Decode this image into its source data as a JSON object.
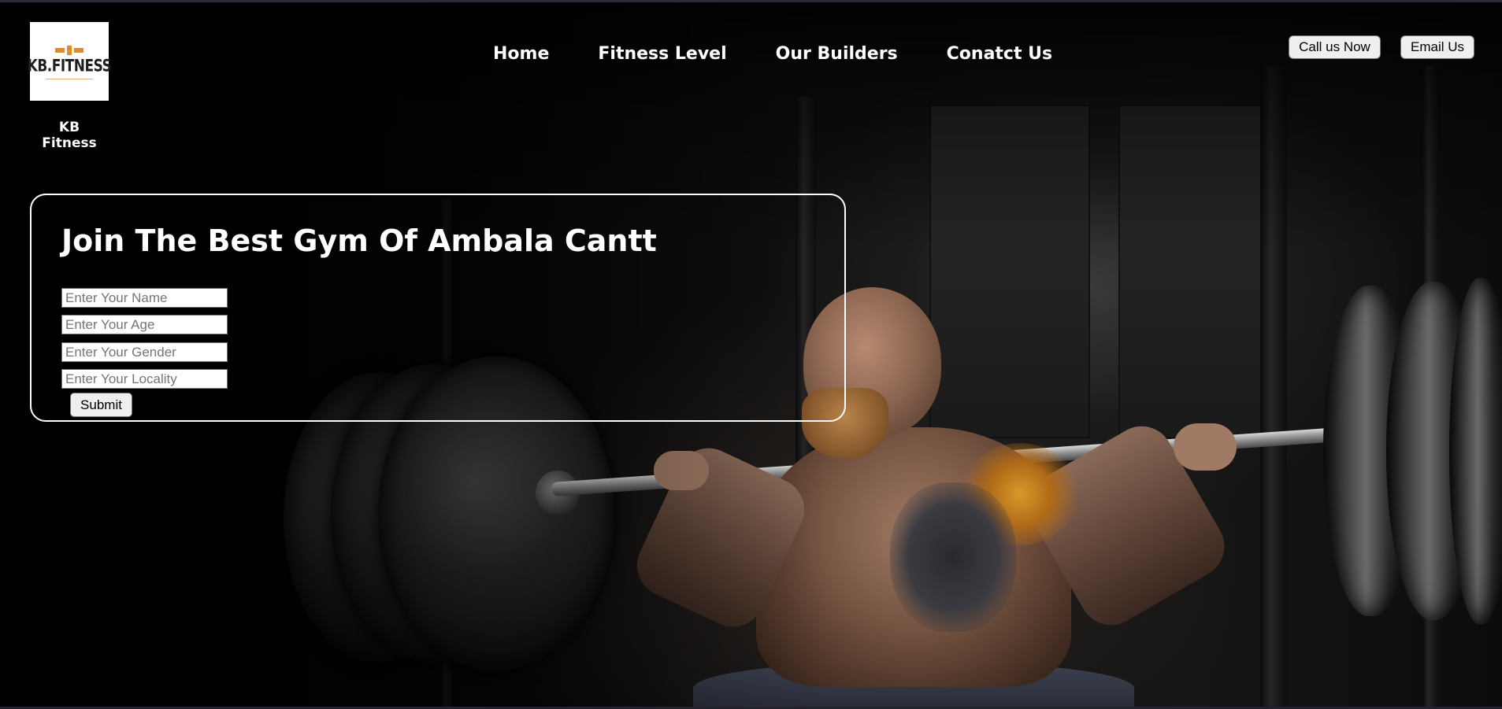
{
  "header": {
    "logo": {
      "icon": "dumbbell-icon",
      "text": "KB.FITNESS",
      "accent_color": "#e08a2a"
    },
    "brand_name": "KB Fitness",
    "nav": [
      {
        "label": "Home"
      },
      {
        "label": "Fitness Level"
      },
      {
        "label": "Our Builders"
      },
      {
        "label": "Conatct Us"
      }
    ],
    "call_button": "Call us Now",
    "email_button": "Email Us"
  },
  "join_form": {
    "title": "Join The Best Gym Of Ambala Cantt",
    "fields": [
      {
        "placeholder": "Enter Your Name",
        "value": ""
      },
      {
        "placeholder": "Enter Your Age",
        "value": ""
      },
      {
        "placeholder": "Enter Your Gender",
        "value": ""
      },
      {
        "placeholder": "Enter Your Locality",
        "value": ""
      }
    ],
    "submit_label": "Submit"
  },
  "colors": {
    "background": "#000000",
    "text": "#ffffff",
    "button_bg": "#efefef"
  }
}
